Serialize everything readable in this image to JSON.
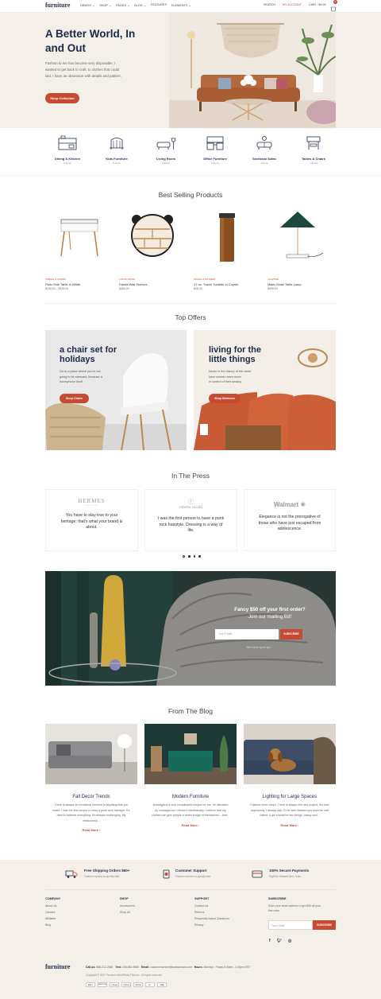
{
  "header": {
    "logo": "furniture",
    "nav": [
      "DEMOS",
      "SHOP",
      "PAGES",
      "BLOG",
      "FEATURES",
      "ELEMENTS"
    ],
    "search": "SEARCH",
    "account": "MY ACCOUNT",
    "cart": "CART / $0.00",
    "cart_count": "0"
  },
  "hero": {
    "title_line1": "A Better World, In",
    "title_line2": "and Out",
    "text_line1": "Fashion to me has become very disposable; I",
    "text_line2": "wanted to get back to craft, to clothes that could",
    "text_line3": "last. I have an obsession with details and pattern.",
    "button": "Shop Collection"
  },
  "categories": [
    {
      "name": "Dining & Kitchen",
      "count": "2 Items",
      "icon": "dining-icon"
    },
    {
      "name": "Kids Furniture",
      "count": "2 Items",
      "icon": "crib-icon"
    },
    {
      "name": "Living Room",
      "count": "3 Items",
      "icon": "sofa-lamp-icon"
    },
    {
      "name": "Office Furniture",
      "count": "1 Items",
      "icon": "office-icon"
    },
    {
      "name": "Sectional Sofas",
      "count": "1 Items",
      "icon": "sectional-icon"
    },
    {
      "name": "Tables & Chairs",
      "count": "1 Items",
      "icon": "table-chair-icon"
    }
  ],
  "best_selling": {
    "title": "Best Selling Products",
    "products": [
      {
        "category": "TABLES & CHAIRS",
        "name": "Plain Side Table in White",
        "price": "$100.00 – $125.00"
      },
      {
        "category": "LIVING ROOM",
        "name": "Panda Wall Shelves",
        "price": "$450.00"
      },
      {
        "category": "DINING & KITCHEN",
        "name": "17 oz. Travel Tumbler in Coyote",
        "price": "$28.00"
      },
      {
        "category": "LIGHTING",
        "name": "Matin Small Table Lamp",
        "price": "$399.00"
      }
    ]
  },
  "top_offers": {
    "title": "Top Offers",
    "offers": [
      {
        "title_line1": "a chair set for",
        "title_line2": "holidays",
        "text_line1": "Go to a place where you're not",
        "text_line2": "going to be stressed, because a",
        "text_line3": "honeymoon itself.",
        "button": "Shop Chairs"
      },
      {
        "title_line1": "living for the",
        "title_line2": "little things",
        "text_line1": "Never in the history of the world",
        "text_line2": "have women been more",
        "text_line3": "in control of their destiny.",
        "button": "Shop Bedroom"
      }
    ]
  },
  "press": {
    "title": "In The Press",
    "items": [
      {
        "brand": "HERMES",
        "brand_sub": "PARIS",
        "quote_line1": "You have to stay true to your",
        "quote_line2": "heritage; that's what your brand is",
        "quote_line3": "about."
      },
      {
        "brand": "roberto cavalli",
        "brand_sub": "",
        "quote_line1": "I was the first person to have a punk",
        "quote_line2": "rock hairstyle. Dressing is a way of",
        "quote_line3": "life."
      },
      {
        "brand": "Walmart",
        "brand_sub": "",
        "quote_line1": "Elegance is not the prerogative of",
        "quote_line2": "those who have just escaped from",
        "quote_line3": "adolescence."
      }
    ]
  },
  "newsletter": {
    "title_line1": "Fancy $50 off your first order?",
    "title_line2": "Join our mailing list!",
    "placeholder": "Your E-Mail",
    "button": "SUBSCRIBE",
    "note": "We'll never spam you."
  },
  "blog": {
    "title": "From The Blog",
    "posts": [
      {
        "title": "Fall Decor Trends",
        "text_line1": "There is always an emotional element to anything that you",
        "text_line2": "make. I was the first person to have a punk rock hairstyle. It's",
        "text_line3": "hard to balance everything. It's always challenging. My",
        "text_line4": "relationship...",
        "link": "Read More"
      },
      {
        "title": "Modern Furniture",
        "text_line1": "Nostalgia is a very complicated subject for me. I'm attracted",
        "text_line2": "by nostalgia but I refuse it intellectually. I believe that my",
        "text_line3": "clothes can give people a better image of themselves – that...",
        "text_line4": "",
        "link": "Read More"
      },
      {
        "title": "Lighting for Large Spaces",
        "text_line1": "Fashion never stops. There is always the new project, the new",
        "text_line2": "opportunity. I always say: To be well dressed you must be well",
        "text_line3": "naked. A girl should be two things: classy and...",
        "text_line4": "",
        "link": "Read More"
      }
    ]
  },
  "features": [
    {
      "title": "Free Shipping Orders $60+",
      "sub": "Fashion moves so quickly that"
    },
    {
      "title": "Customer Support",
      "sub": "Fashion moves so quickly that"
    },
    {
      "title": "100% Secure Payments",
      "sub": "PayPal / MasterCard / Visa"
    }
  ],
  "footer": {
    "columns": [
      {
        "title": "COMPANY",
        "links": [
          "About Us",
          "Careers",
          "Affiliates",
          "Blog"
        ]
      },
      {
        "title": "SHOP",
        "links": [
          "Accessories",
          "Shop All"
        ]
      },
      {
        "title": "SUPPORT",
        "links": [
          "Contact Us",
          "Returns",
          "Frequently Asked Questions",
          "Privacy"
        ]
      }
    ],
    "subscribe": {
      "title": "SUBSCRIBE",
      "text_line1": "Enter your email address to get $50 off your",
      "text_line2": "first order",
      "placeholder": "Your E-Mail",
      "button": "SUBSCRIBE"
    },
    "logo": "furniture",
    "call_label": "Call us:",
    "call": "888-212-2466",
    "text_label": "Text:",
    "text": "208-882-9585",
    "email_label": "Email:",
    "email": "customerservice@luxedomain.com",
    "hours_label": "Hours:",
    "hours": "Monday - Friday 8:30am - 4:30pm EST",
    "copyright": "Copyright © 2020 Premium WordPress Themes . All rights reserved.",
    "payments": [
      "AMEX",
      "MASTERCARD",
      "OPENA",
      "DINERS",
      "PAYPAL",
      "MC",
      "VISA"
    ]
  },
  "colors": {
    "accent": "#c74a32",
    "navy": "#1b2a4a",
    "beige": "#f5efe9"
  }
}
